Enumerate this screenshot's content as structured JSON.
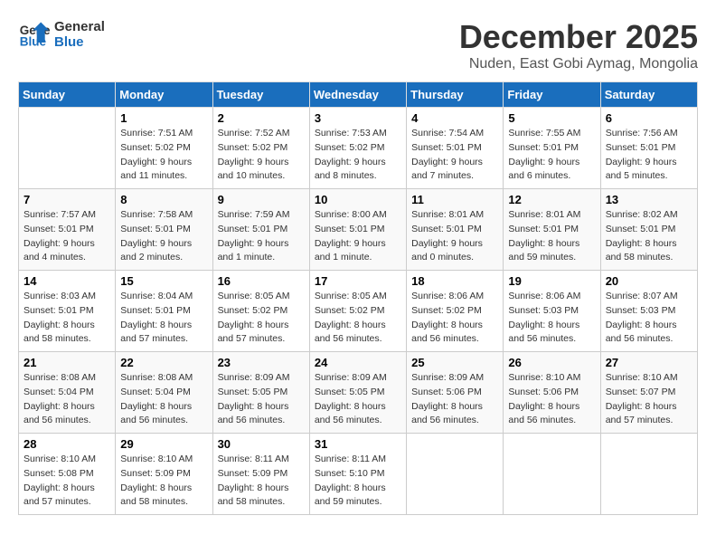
{
  "header": {
    "logo_line1": "General",
    "logo_line2": "Blue",
    "month": "December 2025",
    "location": "Nuden, East Gobi Aymag, Mongolia"
  },
  "weekdays": [
    "Sunday",
    "Monday",
    "Tuesday",
    "Wednesday",
    "Thursday",
    "Friday",
    "Saturday"
  ],
  "weeks": [
    [
      {
        "day": "",
        "info": ""
      },
      {
        "day": "1",
        "info": "Sunrise: 7:51 AM\nSunset: 5:02 PM\nDaylight: 9 hours\nand 11 minutes."
      },
      {
        "day": "2",
        "info": "Sunrise: 7:52 AM\nSunset: 5:02 PM\nDaylight: 9 hours\nand 10 minutes."
      },
      {
        "day": "3",
        "info": "Sunrise: 7:53 AM\nSunset: 5:02 PM\nDaylight: 9 hours\nand 8 minutes."
      },
      {
        "day": "4",
        "info": "Sunrise: 7:54 AM\nSunset: 5:01 PM\nDaylight: 9 hours\nand 7 minutes."
      },
      {
        "day": "5",
        "info": "Sunrise: 7:55 AM\nSunset: 5:01 PM\nDaylight: 9 hours\nand 6 minutes."
      },
      {
        "day": "6",
        "info": "Sunrise: 7:56 AM\nSunset: 5:01 PM\nDaylight: 9 hours\nand 5 minutes."
      }
    ],
    [
      {
        "day": "7",
        "info": "Sunrise: 7:57 AM\nSunset: 5:01 PM\nDaylight: 9 hours\nand 4 minutes."
      },
      {
        "day": "8",
        "info": "Sunrise: 7:58 AM\nSunset: 5:01 PM\nDaylight: 9 hours\nand 2 minutes."
      },
      {
        "day": "9",
        "info": "Sunrise: 7:59 AM\nSunset: 5:01 PM\nDaylight: 9 hours\nand 1 minute."
      },
      {
        "day": "10",
        "info": "Sunrise: 8:00 AM\nSunset: 5:01 PM\nDaylight: 9 hours\nand 1 minute."
      },
      {
        "day": "11",
        "info": "Sunrise: 8:01 AM\nSunset: 5:01 PM\nDaylight: 9 hours\nand 0 minutes."
      },
      {
        "day": "12",
        "info": "Sunrise: 8:01 AM\nSunset: 5:01 PM\nDaylight: 8 hours\nand 59 minutes."
      },
      {
        "day": "13",
        "info": "Sunrise: 8:02 AM\nSunset: 5:01 PM\nDaylight: 8 hours\nand 58 minutes."
      }
    ],
    [
      {
        "day": "14",
        "info": "Sunrise: 8:03 AM\nSunset: 5:01 PM\nDaylight: 8 hours\nand 58 minutes."
      },
      {
        "day": "15",
        "info": "Sunrise: 8:04 AM\nSunset: 5:01 PM\nDaylight: 8 hours\nand 57 minutes."
      },
      {
        "day": "16",
        "info": "Sunrise: 8:05 AM\nSunset: 5:02 PM\nDaylight: 8 hours\nand 57 minutes."
      },
      {
        "day": "17",
        "info": "Sunrise: 8:05 AM\nSunset: 5:02 PM\nDaylight: 8 hours\nand 56 minutes."
      },
      {
        "day": "18",
        "info": "Sunrise: 8:06 AM\nSunset: 5:02 PM\nDaylight: 8 hours\nand 56 minutes."
      },
      {
        "day": "19",
        "info": "Sunrise: 8:06 AM\nSunset: 5:03 PM\nDaylight: 8 hours\nand 56 minutes."
      },
      {
        "day": "20",
        "info": "Sunrise: 8:07 AM\nSunset: 5:03 PM\nDaylight: 8 hours\nand 56 minutes."
      }
    ],
    [
      {
        "day": "21",
        "info": "Sunrise: 8:08 AM\nSunset: 5:04 PM\nDaylight: 8 hours\nand 56 minutes."
      },
      {
        "day": "22",
        "info": "Sunrise: 8:08 AM\nSunset: 5:04 PM\nDaylight: 8 hours\nand 56 minutes."
      },
      {
        "day": "23",
        "info": "Sunrise: 8:09 AM\nSunset: 5:05 PM\nDaylight: 8 hours\nand 56 minutes."
      },
      {
        "day": "24",
        "info": "Sunrise: 8:09 AM\nSunset: 5:05 PM\nDaylight: 8 hours\nand 56 minutes."
      },
      {
        "day": "25",
        "info": "Sunrise: 8:09 AM\nSunset: 5:06 PM\nDaylight: 8 hours\nand 56 minutes."
      },
      {
        "day": "26",
        "info": "Sunrise: 8:10 AM\nSunset: 5:06 PM\nDaylight: 8 hours\nand 56 minutes."
      },
      {
        "day": "27",
        "info": "Sunrise: 8:10 AM\nSunset: 5:07 PM\nDaylight: 8 hours\nand 57 minutes."
      }
    ],
    [
      {
        "day": "28",
        "info": "Sunrise: 8:10 AM\nSunset: 5:08 PM\nDaylight: 8 hours\nand 57 minutes."
      },
      {
        "day": "29",
        "info": "Sunrise: 8:10 AM\nSunset: 5:09 PM\nDaylight: 8 hours\nand 58 minutes."
      },
      {
        "day": "30",
        "info": "Sunrise: 8:11 AM\nSunset: 5:09 PM\nDaylight: 8 hours\nand 58 minutes."
      },
      {
        "day": "31",
        "info": "Sunrise: 8:11 AM\nSunset: 5:10 PM\nDaylight: 8 hours\nand 59 minutes."
      },
      {
        "day": "",
        "info": ""
      },
      {
        "day": "",
        "info": ""
      },
      {
        "day": "",
        "info": ""
      }
    ]
  ]
}
